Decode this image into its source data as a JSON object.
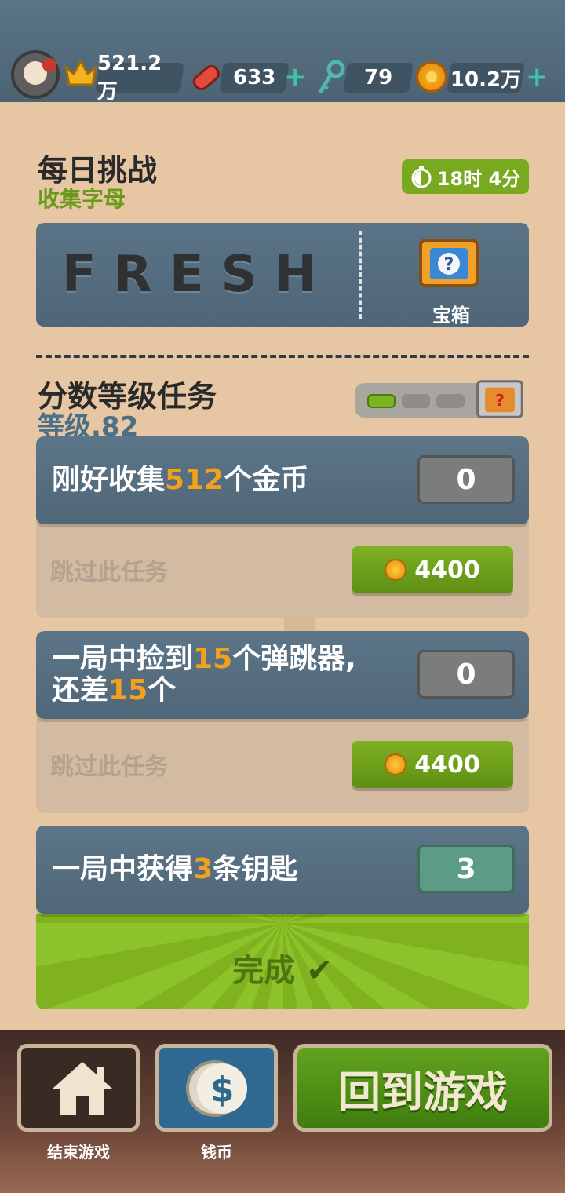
{
  "top_stats": {
    "crown_score": "521.2万",
    "boards": "633",
    "keys": "79",
    "coins": "10.2万",
    "plus_symbol": "+"
  },
  "daily_challenge": {
    "title": "每日挑战",
    "subtitle": "收集字母",
    "timer": "18时 4分",
    "word": "FRESH",
    "reward_label": "宝箱"
  },
  "score_missions": {
    "title": "分数等级任务",
    "level": "等级.82",
    "progress_filled": 1,
    "progress_total": 3,
    "watermark": "1"
  },
  "tasks": [
    {
      "text_a": "刚好收集",
      "hl_a": "512",
      "text_b": "个金币",
      "text_c": "",
      "hl_b": "",
      "text_d": "",
      "counter": "0",
      "skip_label": "跳过此任务",
      "skip_cost": "4400"
    },
    {
      "text_a": "一局中捡到",
      "hl_a": "15",
      "text_b": "个弹跳器,",
      "text_c": "还差",
      "hl_b": "15",
      "text_d": "个",
      "counter": "0",
      "skip_label": "跳过此任务",
      "skip_cost": "4400"
    },
    {
      "text_a": "一局中获得",
      "hl_a": "3",
      "text_b": "条钥匙",
      "counter": "3",
      "done_label": "完成"
    }
  ],
  "bottom": {
    "end_game": "结束游戏",
    "coins": "钱币",
    "back_to_game": "回到游戏"
  },
  "colors": {
    "accent_green": "#79a91f",
    "highlight_orange": "#f2a11f",
    "slate": "#4f6778"
  }
}
